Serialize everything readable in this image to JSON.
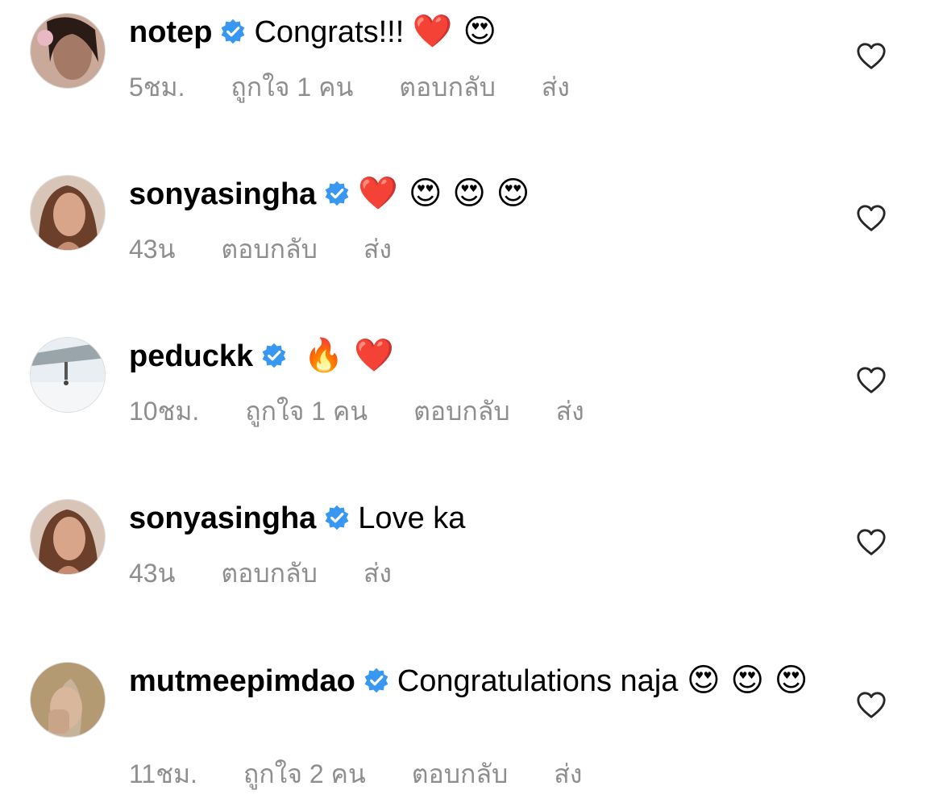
{
  "comments": [
    {
      "username": "notep",
      "text": "Congrats!!!",
      "emojis": "❤️ 😍",
      "time": "5ชม.",
      "likes": "ถูกใจ 1 คน",
      "reply": "ตอบกลับ",
      "send": "ส่ง"
    },
    {
      "username": "sonyasingha",
      "text": "",
      "emojis": "❤️ 😍 😍 😍",
      "time": "43น",
      "likes": "",
      "reply": "ตอบกลับ",
      "send": "ส่ง"
    },
    {
      "username": "peduckk",
      "text": "",
      "emojis": "🔥 ❤️",
      "time": "10ชม.",
      "likes": "ถูกใจ 1 คน",
      "reply": "ตอบกลับ",
      "send": "ส่ง"
    },
    {
      "username": "sonyasingha",
      "text": "Love ka",
      "emojis": "",
      "time": "43น",
      "likes": "",
      "reply": "ตอบกลับ",
      "send": "ส่ง"
    },
    {
      "username": "mutmeepimdao",
      "text": "Congratulations naja",
      "emojis": "😍 😍 😍",
      "time": "11ชม.",
      "likes": "ถูกใจ 2 คน",
      "reply": "ตอบกลับ",
      "send": "ส่ง"
    }
  ],
  "colors": {
    "verified": "#3897f0",
    "meta_text": "#8e8e8e",
    "heart_outline": "#262626"
  },
  "icons": {
    "verified": "verified-badge-icon",
    "like": "heart-outline-icon"
  }
}
